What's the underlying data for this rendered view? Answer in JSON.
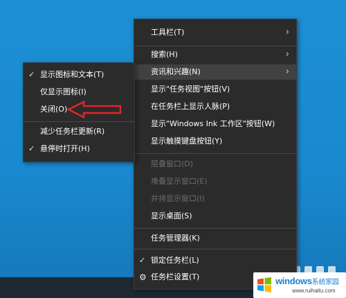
{
  "main_menu": {
    "items": [
      {
        "label": "工具栏(T)",
        "has_submenu": true,
        "disabled": false
      },
      {
        "label": "搜索(H)",
        "has_submenu": true,
        "disabled": false
      },
      {
        "label": "资讯和兴趣(N)",
        "has_submenu": true,
        "disabled": false,
        "highlighted": true
      },
      {
        "label": "显示\"任务视图\"按钮(V)",
        "disabled": false
      },
      {
        "label": "在任务栏上显示人脉(P)",
        "disabled": false
      },
      {
        "label": "显示\"Windows Ink 工作区\"按钮(W)",
        "disabled": false
      },
      {
        "label": "显示触摸键盘按钮(Y)",
        "disabled": false
      },
      {
        "label": "层叠窗口(D)",
        "disabled": true
      },
      {
        "label": "堆叠显示窗口(E)",
        "disabled": true
      },
      {
        "label": "并排显示窗口(I)",
        "disabled": true
      },
      {
        "label": "显示桌面(S)",
        "disabled": false
      },
      {
        "label": "任务管理器(K)",
        "disabled": false
      },
      {
        "label": "锁定任务栏(L)",
        "checked": true
      },
      {
        "label": "任务栏设置(T)",
        "icon": "gear-icon"
      }
    ]
  },
  "sub_menu": {
    "items": [
      {
        "label": "显示图标和文本(T)",
        "checked": true
      },
      {
        "label": "仅显示图标(I)",
        "checked": false
      },
      {
        "label": "关闭(O)",
        "checked": false
      },
      {
        "label": "减少任务栏更新(R)",
        "checked": false
      },
      {
        "label": "悬停时打开(H)",
        "checked": true
      }
    ]
  },
  "watermark": {
    "title": "windows",
    "suffix": "系统家园",
    "url": "www.ruihaitu.com"
  },
  "icons": {
    "submenu_arrow": "›",
    "check": "✓",
    "gear": "⚙"
  },
  "colors": {
    "desktop": "#1a8ad0",
    "menu_bg": "#2b2b2b",
    "annotation_arrow": "#e0242b"
  }
}
